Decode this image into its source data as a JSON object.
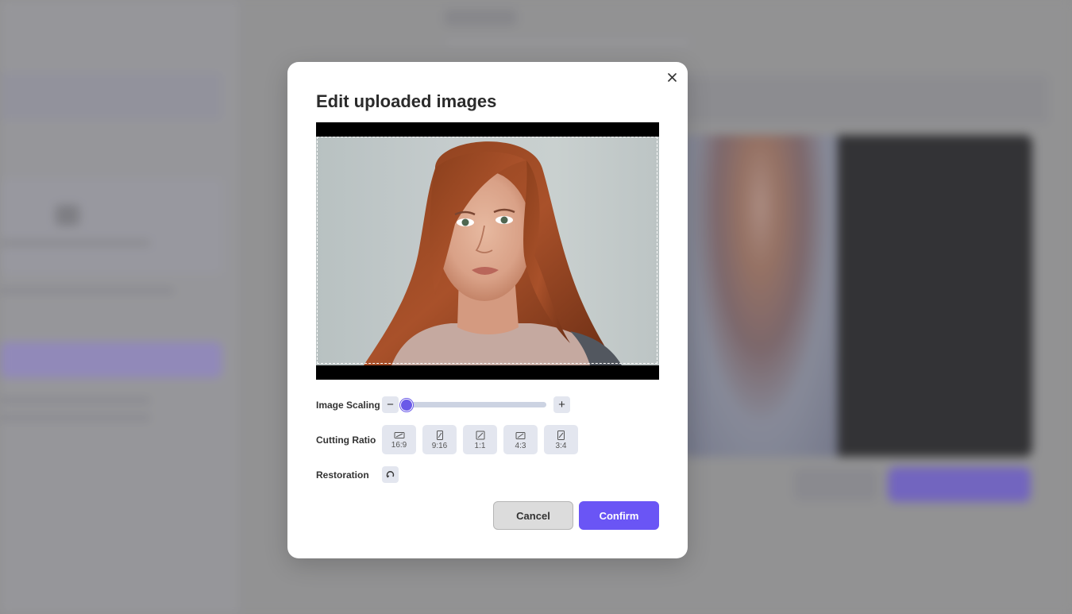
{
  "modal": {
    "title": "Edit uploaded images",
    "close_icon": "close-icon"
  },
  "scaling": {
    "label": "Image Scaling",
    "minus_symbol": "−",
    "plus_symbol": "+",
    "value_fraction": 0.0
  },
  "cutting_ratio": {
    "label": "Cutting Ratio",
    "options": [
      {
        "label": "16:9",
        "icon": "ratio-16-9-icon"
      },
      {
        "label": "9:16",
        "icon": "ratio-9-16-icon"
      },
      {
        "label": "1:1",
        "icon": "ratio-1-1-icon"
      },
      {
        "label": "4:3",
        "icon": "ratio-4-3-icon"
      },
      {
        "label": "3:4",
        "icon": "ratio-3-4-icon"
      }
    ]
  },
  "restoration": {
    "label": "Restoration",
    "icon": "restore-icon"
  },
  "buttons": {
    "cancel": "Cancel",
    "confirm": "Confirm"
  },
  "colors": {
    "accent": "#6a55f5",
    "control_bg": "#e3e6ef"
  }
}
